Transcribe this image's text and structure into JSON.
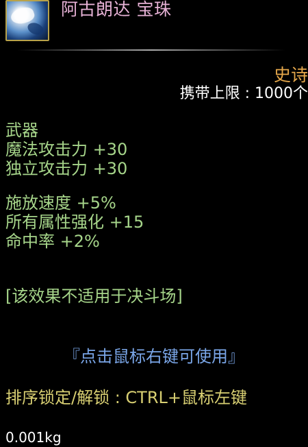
{
  "item": {
    "name": "阿古朗达 宝珠",
    "icon": "orb-icon",
    "rarity": "史诗",
    "carry_limit": "携带上限 : 1000个"
  },
  "stats": {
    "type": "武器",
    "lines_group1": [
      "魔法攻击力 +30",
      "独立攻击力 +30"
    ],
    "lines_group2": [
      "施放速度 +5%",
      "所有属性强化 +15",
      "命中率 +2%"
    ],
    "note": "[该效果不适用于决斗场]"
  },
  "hints": {
    "use": "『点击鼠标右键可使用』",
    "lock": "排序锁定/解锁 : CTRL+鼠标左键",
    "weight": "0.001kg"
  },
  "colors": {
    "name": "#e7b2d6",
    "rarity": "#e6a84b",
    "stats": "#a6d58a",
    "use_hint": "#7aa6e8",
    "lock_hint": "#d8cf72",
    "background": "#000000"
  }
}
